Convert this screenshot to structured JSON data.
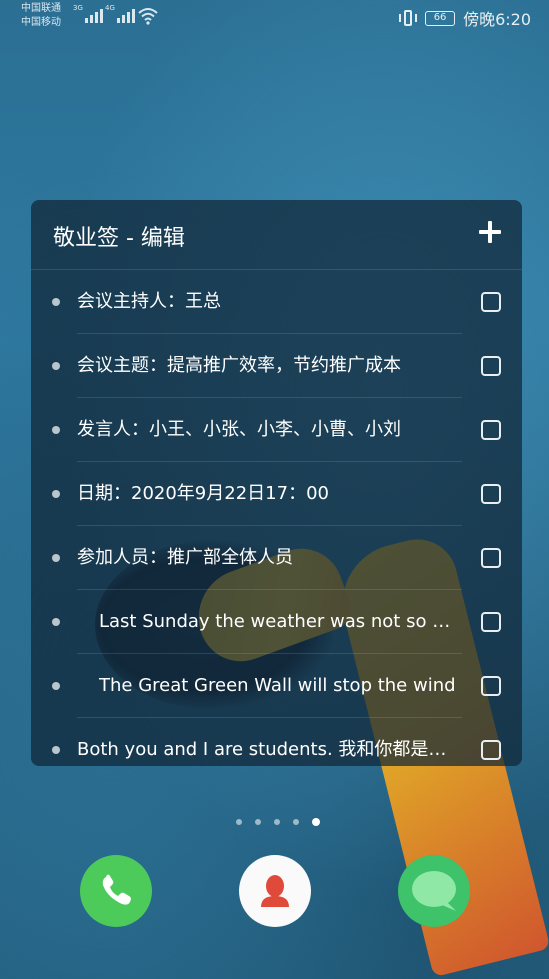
{
  "status_bar": {
    "carrier_1": "中国联通",
    "carrier_2": "中国移动",
    "network_1": "3G",
    "network_2": "4G",
    "battery": "66",
    "time": "傍晚6:20",
    "icons": [
      "signal-icon",
      "wifi-icon",
      "vibrate-icon",
      "battery-icon"
    ]
  },
  "widget": {
    "title": "敬业签 - 编辑",
    "add_icon": "plus-icon",
    "items": [
      {
        "text": "会议主持人：王总",
        "checked": false
      },
      {
        "text": "会议主题：提高推广效率，节约推广成本",
        "checked": false
      },
      {
        "text": "发言人：小王、小张、小李、小曹、小刘",
        "checked": false
      },
      {
        "text": "日期：2020年9月22日17：00",
        "checked": false
      },
      {
        "text": "参加人员：推广部全体人员",
        "checked": false
      },
      {
        "text": "Last Sunday the weather was not so good",
        "checked": false
      },
      {
        "text": "The Great Green Wall will stop the wind",
        "checked": false
      },
      {
        "text": "Both you and I are students. 我和你都是学生",
        "checked": false
      }
    ]
  },
  "page_indicator": {
    "count": 5,
    "active_index": 4
  },
  "dock": {
    "apps": [
      "phone-icon",
      "contacts-icon",
      "messages-icon"
    ],
    "colors": {
      "phone": "#4cca5a",
      "contacts": "#fafafa",
      "messages": "#3ec26a"
    }
  }
}
